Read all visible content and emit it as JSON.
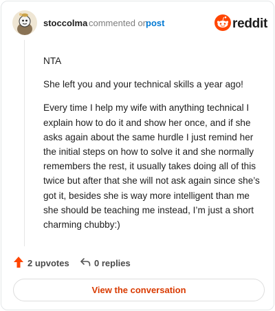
{
  "header": {
    "username": "stoccolma",
    "commented_text": "commented on",
    "post_link": "post",
    "brand": "reddit"
  },
  "comment": {
    "paragraphs": [
      "NTA",
      "She left you and your technical skills a year ago!",
      "Every time I help my wife with anything technical I explain how to do it and show her once, and if she asks again about the same hurdle I just remind her the initial steps on how to solve it and she normally remembers the rest, it usually takes doing all of this twice but after that she will not ask again since she’s got it, besides she is way more intelligent than me she should be teaching me instead, I’m just a short charming chubby:)"
    ]
  },
  "actions": {
    "upvotes": "2 upvotes",
    "replies": "0 replies",
    "view_button": "View the conversation"
  },
  "colors": {
    "upvote": "#ff4500",
    "link": "#0079d3",
    "button_text": "#d93a00"
  },
  "icons": [
    "avatar",
    "reddit-logo-icon",
    "upvote-icon",
    "reply-icon"
  ]
}
